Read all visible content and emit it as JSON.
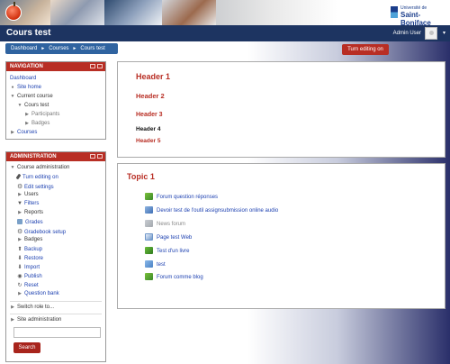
{
  "header": {
    "site_title": "Cours test",
    "brand_line1": "Université de",
    "brand_line2": "Saint-Boniface",
    "user_label": "Admin User",
    "caret": "▾"
  },
  "breadcrumb": {
    "items": [
      "Dashboard",
      "Courses",
      "Cours test"
    ],
    "separator": "►"
  },
  "toolbar": {
    "turn_editing_label": "Turn editing on"
  },
  "navigation": {
    "title": "NAVIGATION",
    "items": [
      {
        "label": "Dashboard"
      },
      {
        "label": "Site home"
      },
      {
        "label": "Current course"
      },
      {
        "label": "Cours test"
      },
      {
        "label": "Participants"
      },
      {
        "label": "Badges"
      },
      {
        "label": "Courses"
      }
    ]
  },
  "administration": {
    "title": "ADMINISTRATION",
    "items": [
      {
        "label": "Course administration"
      },
      {
        "label": "Turn editing on"
      },
      {
        "label": "Edit settings"
      },
      {
        "label": "Users"
      },
      {
        "label": "Filters"
      },
      {
        "label": "Reports"
      },
      {
        "label": "Grades"
      },
      {
        "label": "Gradebook setup"
      },
      {
        "label": "Badges"
      },
      {
        "label": "Backup"
      },
      {
        "label": "Restore"
      },
      {
        "label": "Import"
      },
      {
        "label": "Publish"
      },
      {
        "label": "Reset"
      },
      {
        "label": "Question bank"
      }
    ],
    "switch_role_label": "Switch role to...",
    "site_admin_label": "Site administration",
    "search_placeholder": "",
    "search_button_label": "Search"
  },
  "headers_panel": {
    "h1": "Header 1",
    "h2": "Header 2",
    "h3": "Header 3",
    "h4": "Header 4",
    "h5": "Header 5"
  },
  "topic": {
    "title": "Topic 1",
    "activities": [
      {
        "label": "Forum question réponses",
        "icon": "forum-icon"
      },
      {
        "label": "Devoir test de l'outil assignsubmission online audio",
        "icon": "assignment-icon"
      },
      {
        "label": "News forum",
        "icon": "forum-icon"
      },
      {
        "label": "Page test Web",
        "icon": "page-icon"
      },
      {
        "label": "Test d'un livre",
        "icon": "book-icon"
      },
      {
        "label": "test",
        "icon": "folder-icon"
      },
      {
        "label": "Forum comme blog",
        "icon": "forum-icon"
      }
    ]
  },
  "colors": {
    "accent_red": "#b82e24",
    "navy": "#1d3461",
    "breadcrumb_blue": "#2f63a0",
    "link_blue": "#1b3fb0"
  }
}
